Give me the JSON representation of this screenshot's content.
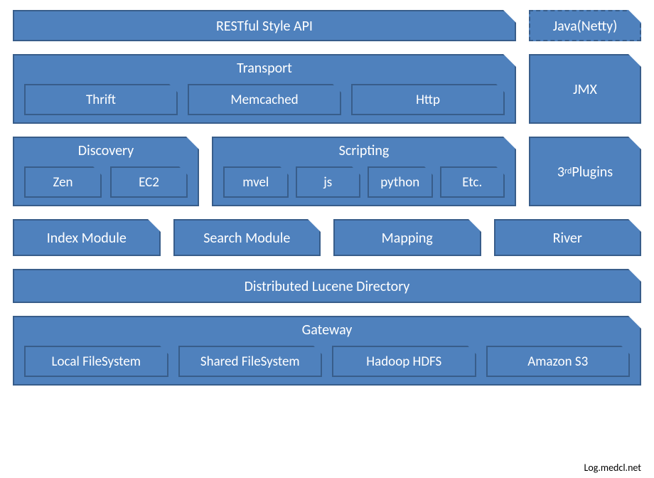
{
  "row1": {
    "api": "RESTful Style API",
    "java": "Java(Netty)"
  },
  "row2": {
    "transport": {
      "title": "Transport",
      "items": [
        "Thrift",
        "Memcached",
        "Http"
      ]
    },
    "jmx": "JMX"
  },
  "row3": {
    "discovery": {
      "title": "Discovery",
      "items": [
        "Zen",
        "EC2"
      ]
    },
    "scripting": {
      "title": "Scripting",
      "items": [
        "mvel",
        "js",
        "python",
        "Etc."
      ]
    },
    "plugins_pre": "3",
    "plugins_sup": "rd",
    "plugins_post": " Plugins"
  },
  "row4": {
    "items": [
      "Index Module",
      "Search Module",
      "Mapping",
      "River"
    ]
  },
  "row5": {
    "dld": "Distributed Lucene Directory"
  },
  "row6": {
    "gateway": {
      "title": "Gateway",
      "items": [
        "Local FileSystem",
        "Shared FileSystem",
        "Hadoop HDFS",
        "Amazon S3"
      ]
    }
  },
  "footer": "Log.medcl.net"
}
